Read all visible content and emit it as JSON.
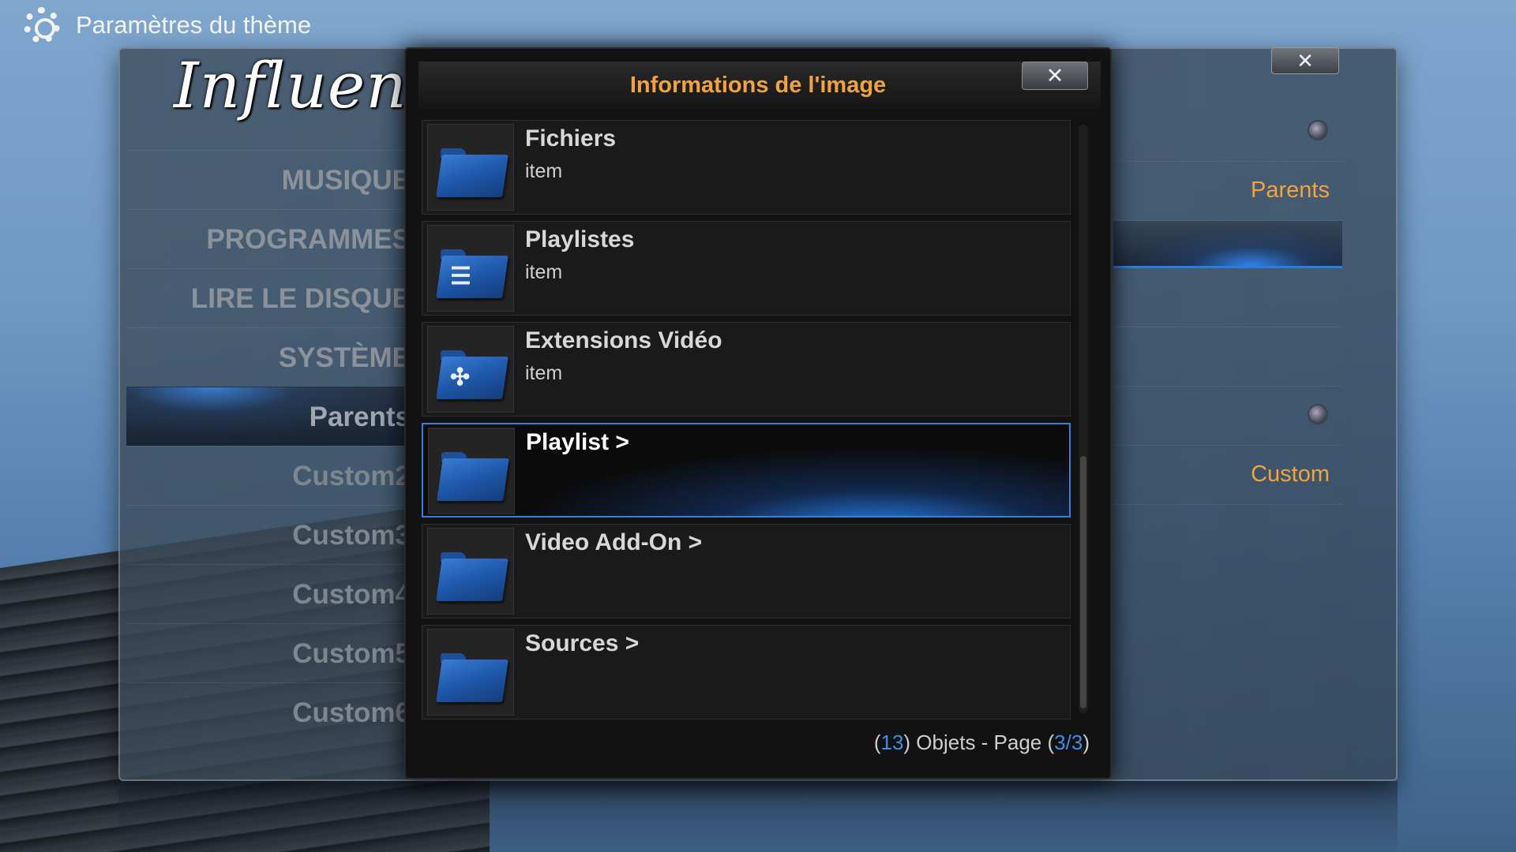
{
  "header": {
    "title": "Paramètres du thème",
    "icon": "gear-icon"
  },
  "logo": {
    "text": "Influence"
  },
  "left_menu": {
    "items": [
      {
        "label": "MUSIQUE"
      },
      {
        "label": "PROGRAMMES"
      },
      {
        "label": "LIRE LE DISQUE"
      },
      {
        "label": "SYSTÈME"
      },
      {
        "label": "Parents",
        "selected": true
      },
      {
        "label": "Custom2"
      },
      {
        "label": "Custom3"
      },
      {
        "label": "Custom4"
      },
      {
        "label": "Custom5"
      },
      {
        "label": "Custom6"
      }
    ]
  },
  "right_settings": {
    "values": [
      "Parents",
      "Custom"
    ],
    "close_label": "✕"
  },
  "dialog": {
    "title": "Informations de l'image",
    "close_label": "✕",
    "items": [
      {
        "title": "Fichiers",
        "subtitle": "item",
        "icon": "folder-icon"
      },
      {
        "title": "Playlistes",
        "subtitle": "item",
        "icon": "playlist-folder-icon"
      },
      {
        "title": "Extensions Vidéo",
        "subtitle": "item",
        "icon": "video-addon-folder-icon"
      },
      {
        "title": "Playlist  >",
        "subtitle": "",
        "icon": "folder-icon",
        "selected": true
      },
      {
        "title": "Video Add-On  >",
        "subtitle": "",
        "icon": "folder-icon"
      },
      {
        "title": "Sources  >",
        "subtitle": "",
        "icon": "folder-icon"
      }
    ],
    "footer": {
      "count": "13",
      "objects_label": "Objets - Page",
      "page": "3/3"
    }
  },
  "colors": {
    "accent": "#f0a43a",
    "highlight": "#3d8fe8"
  }
}
